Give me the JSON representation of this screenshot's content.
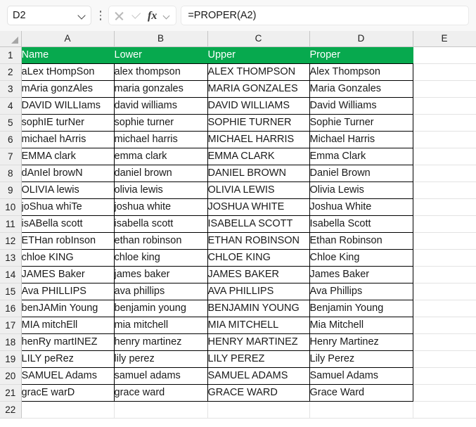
{
  "formula_bar": {
    "name_box_value": "D2",
    "formula_value": "=PROPER(A2)",
    "icons": {
      "name_box_chevron": "chevron-down-icon",
      "kebab": "more-options-icon",
      "cancel": "cancel-icon",
      "accept": "accept-icon",
      "fx": "fx-icon",
      "fx_chevron": "chevron-down-icon"
    },
    "fx_label": "fx"
  },
  "grid": {
    "select_all_icon": "select-all-triangle-icon",
    "column_headers": [
      "A",
      "B",
      "C",
      "D",
      "E"
    ],
    "row_numbers": [
      "1",
      "2",
      "3",
      "4",
      "5",
      "6",
      "7",
      "8",
      "9",
      "10",
      "11",
      "12",
      "13",
      "14",
      "15",
      "16",
      "17",
      "18",
      "19",
      "20",
      "21",
      "22"
    ],
    "header_fill": "#07a94e",
    "header_text_color": "#ffffff",
    "table_headers": [
      "Name",
      "Lower",
      "Upper",
      "Proper"
    ],
    "rows": [
      [
        "aLex tHompSon",
        "alex thompson",
        "ALEX THOMPSON",
        "Alex Thompson"
      ],
      [
        "mAria gonzAles",
        "maria gonzales",
        "MARIA GONZALES",
        "Maria Gonzales"
      ],
      [
        "DAVID WILLIams",
        "david williams",
        "DAVID WILLIAMS",
        "David Williams"
      ],
      [
        "sophIE turNer",
        "sophie turner",
        "SOPHIE TURNER",
        "Sophie Turner"
      ],
      [
        "michael hArris",
        "michael harris",
        "MICHAEL HARRIS",
        "Michael Harris"
      ],
      [
        "EMMA clark",
        "emma clark",
        "EMMA CLARK",
        "Emma Clark"
      ],
      [
        "dAnIel browN",
        "daniel brown",
        "DANIEL BROWN",
        "Daniel Brown"
      ],
      [
        "OLIVIA lewis",
        "olivia lewis",
        "OLIVIA LEWIS",
        "Olivia Lewis"
      ],
      [
        "joShua whiTe",
        "joshua white",
        "JOSHUA WHITE",
        "Joshua White"
      ],
      [
        "isABella scott",
        "isabella scott",
        "ISABELLA SCOTT",
        "Isabella Scott"
      ],
      [
        "ETHan robInson",
        "ethan robinson",
        "ETHAN ROBINSON",
        "Ethan Robinson"
      ],
      [
        "chloe KING",
        "chloe king",
        "CHLOE KING",
        "Chloe King"
      ],
      [
        "JAMES Baker",
        "james baker",
        "JAMES BAKER",
        "James Baker"
      ],
      [
        "Ava PHILLIPS",
        "ava phillips",
        "AVA PHILLIPS",
        "Ava Phillips"
      ],
      [
        "benJAMin Young",
        "benjamin young",
        "BENJAMIN YOUNG",
        "Benjamin Young"
      ],
      [
        "MIA mitchEll",
        "mia mitchell",
        "MIA MITCHELL",
        "Mia Mitchell"
      ],
      [
        "henRy martINEZ",
        "henry martinez",
        "HENRY MARTINEZ",
        "Henry Martinez"
      ],
      [
        "LILY peRez",
        "lily perez",
        "LILY PEREZ",
        "Lily Perez"
      ],
      [
        "SAMUEL Adams",
        "samuel adams",
        "SAMUEL ADAMS",
        "Samuel Adams"
      ],
      [
        "gracE warD",
        "grace ward",
        "GRACE WARD",
        "Grace Ward"
      ]
    ],
    "active_cell": "D2"
  }
}
